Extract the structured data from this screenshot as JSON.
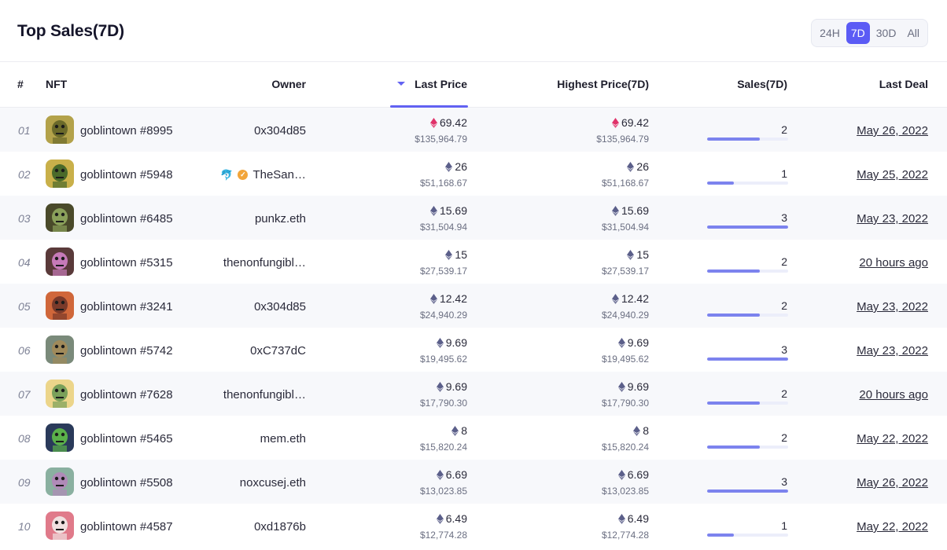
{
  "header": {
    "title": "Top Sales(7D)",
    "ranges": [
      "24H",
      "7D",
      "30D",
      "All"
    ],
    "active_range": "7D"
  },
  "columns": {
    "rank": "#",
    "nft": "NFT",
    "owner": "Owner",
    "last_price": "Last Price",
    "highest_price": "Highest Price(7D)",
    "sales": "Sales(7D)",
    "last_deal": "Last Deal"
  },
  "sort": {
    "column": "last_price",
    "direction": "desc"
  },
  "colors": {
    "accent": "#5b5bf5",
    "bar": "#7c83ee",
    "weth": "#e0336a",
    "eth": "#5b5f8a"
  },
  "rows": [
    {
      "rank": "01",
      "nft": "goblintown #8995",
      "owner": "0x304d85",
      "last_eth": "69.42",
      "last_usd": "$135,964.79",
      "high_eth": "69.42",
      "high_usd": "$135,964.79",
      "currency": "weth",
      "sales": "2",
      "sales_level": 0.65,
      "last_deal": "May 26, 2022",
      "thumb_bg": "#b3a24a",
      "thumb_fg": "#6b6a2a"
    },
    {
      "rank": "02",
      "nft": "goblintown #5948",
      "owner": "TheSan…",
      "owner_badges": [
        "dolphin-icon",
        "verified-icon"
      ],
      "last_eth": "26",
      "last_usd": "$51,168.67",
      "high_eth": "26",
      "high_usd": "$51,168.67",
      "currency": "eth",
      "sales": "1",
      "sales_level": 0.33,
      "last_deal": "May 25, 2022",
      "thumb_bg": "#c9b04a",
      "thumb_fg": "#4a6a2a"
    },
    {
      "rank": "03",
      "nft": "goblintown #6485",
      "owner": "punkz.eth",
      "last_eth": "15.69",
      "last_usd": "$31,504.94",
      "high_eth": "15.69",
      "high_usd": "$31,504.94",
      "currency": "eth",
      "sales": "3",
      "sales_level": 1.0,
      "last_deal": "May 23, 2022",
      "thumb_bg": "#4a4a2a",
      "thumb_fg": "#8aa05a"
    },
    {
      "rank": "04",
      "nft": "goblintown #5315",
      "owner": "thenonfungibl…",
      "last_eth": "15",
      "last_usd": "$27,539.17",
      "high_eth": "15",
      "high_usd": "$27,539.17",
      "currency": "eth",
      "sales": "2",
      "sales_level": 0.65,
      "last_deal": "20 hours ago",
      "thumb_bg": "#5a3a3a",
      "thumb_fg": "#c67ab8"
    },
    {
      "rank": "05",
      "nft": "goblintown #3241",
      "owner": "0x304d85",
      "last_eth": "12.42",
      "last_usd": "$24,940.29",
      "high_eth": "12.42",
      "high_usd": "$24,940.29",
      "currency": "eth",
      "sales": "2",
      "sales_level": 0.65,
      "last_deal": "May 23, 2022",
      "thumb_bg": "#d0673a",
      "thumb_fg": "#7a3a2a"
    },
    {
      "rank": "06",
      "nft": "goblintown #5742",
      "owner": "0xC737dC",
      "last_eth": "9.69",
      "last_usd": "$19,495.62",
      "high_eth": "9.69",
      "high_usd": "$19,495.62",
      "currency": "eth",
      "sales": "3",
      "sales_level": 1.0,
      "last_deal": "May 23, 2022",
      "thumb_bg": "#7a8a7a",
      "thumb_fg": "#a08a5a"
    },
    {
      "rank": "07",
      "nft": "goblintown #7628",
      "owner": "thenonfungibl…",
      "last_eth": "9.69",
      "last_usd": "$17,790.30",
      "high_eth": "9.69",
      "high_usd": "$17,790.30",
      "currency": "eth",
      "sales": "2",
      "sales_level": 0.65,
      "last_deal": "20 hours ago",
      "thumb_bg": "#ecd58a",
      "thumb_fg": "#7aa05a"
    },
    {
      "rank": "08",
      "nft": "goblintown #5465",
      "owner": "mem.eth",
      "last_eth": "8",
      "last_usd": "$15,820.24",
      "high_eth": "8",
      "high_usd": "$15,820.24",
      "currency": "eth",
      "sales": "2",
      "sales_level": 0.65,
      "last_deal": "May 22, 2022",
      "thumb_bg": "#2a3a5a",
      "thumb_fg": "#5ab04a"
    },
    {
      "rank": "09",
      "nft": "goblintown #5508",
      "owner": "noxcusej.eth",
      "last_eth": "6.69",
      "last_usd": "$13,023.85",
      "high_eth": "6.69",
      "high_usd": "$13,023.85",
      "currency": "eth",
      "sales": "3",
      "sales_level": 1.0,
      "last_deal": "May 26, 2022",
      "thumb_bg": "#8ab0a0",
      "thumb_fg": "#b08ab8"
    },
    {
      "rank": "10",
      "nft": "goblintown #4587",
      "owner": "0xd1876b",
      "last_eth": "6.49",
      "last_usd": "$12,774.28",
      "high_eth": "6.49",
      "high_usd": "$12,774.28",
      "currency": "eth",
      "sales": "1",
      "sales_level": 0.33,
      "last_deal": "May 22, 2022",
      "thumb_bg": "#e07a8a",
      "thumb_fg": "#f0e0e0"
    }
  ]
}
